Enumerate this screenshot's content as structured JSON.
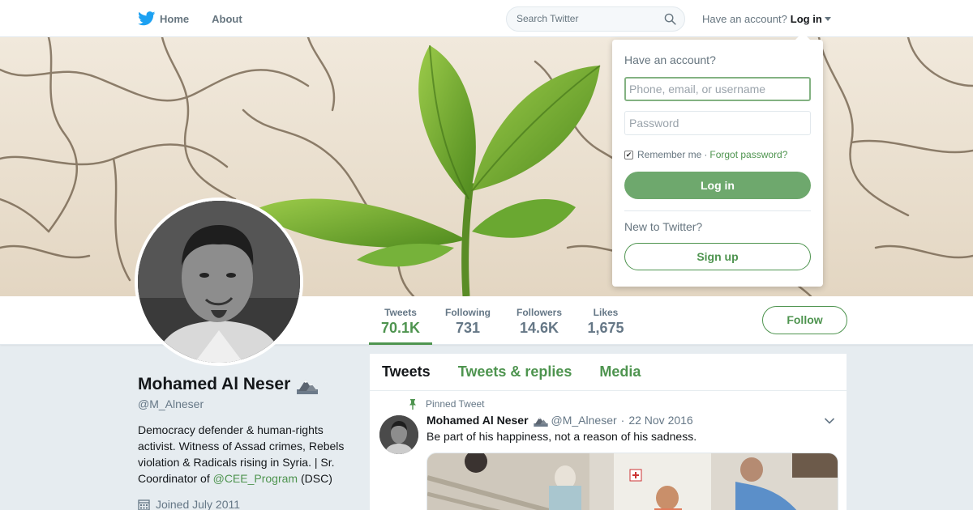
{
  "colors": {
    "accent": "#4e944f",
    "link": "#4e944f",
    "background": "#e6ecf0"
  },
  "nav": {
    "home_label": "Home",
    "about_label": "About",
    "search_placeholder": "Search Twitter",
    "account_prompt": "Have an account?",
    "login_label": "Log in"
  },
  "login_dropdown": {
    "title": "Have an account?",
    "username_placeholder": "Phone, email, or username",
    "password_placeholder": "Password",
    "remember_label": "Remember me",
    "separator": "·",
    "forgot_label": "Forgot password?",
    "remember_checked": true,
    "login_button": "Log in",
    "new_prompt": "New to Twitter?",
    "signup_button": "Sign up"
  },
  "profile": {
    "name": "Mohamed Al Neser",
    "handle": "@M_Alneser",
    "bio_before": "Democracy defender & human-rights activist. Witness of Assad crimes, Rebels violation & Radicals rising in Syria. | Sr. Coordinator of ",
    "bio_mention": "@CEE_Program",
    "bio_after": " (DSC)",
    "joined": "Joined July 2011"
  },
  "stats": [
    {
      "label": "Tweets",
      "value": "70.1K",
      "active": true
    },
    {
      "label": "Following",
      "value": "731",
      "active": false
    },
    {
      "label": "Followers",
      "value": "14.6K",
      "active": false
    },
    {
      "label": "Likes",
      "value": "1,675",
      "active": false
    }
  ],
  "follow_button": "Follow",
  "timeline": {
    "tabs": [
      "Tweets",
      "Tweets & replies",
      "Media"
    ],
    "active_tab": 0,
    "pinned_label": "Pinned Tweet",
    "tweet": {
      "name": "Mohamed Al Neser",
      "handle": "@M_Alneser",
      "separator": "·",
      "date": "22 Nov 2016",
      "text": "Be part of his happiness, not a reason of his sadness."
    }
  }
}
